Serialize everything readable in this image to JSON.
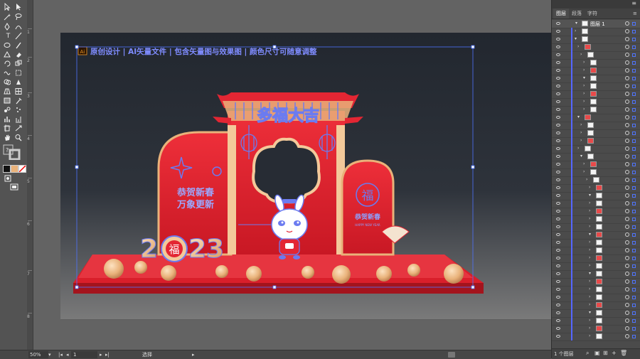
{
  "statusbar": {
    "zoom": "50%",
    "artboard_number": "1",
    "tool_name": "选择"
  },
  "panel": {
    "tabs": [
      "图层",
      "段落",
      "字符"
    ],
    "top_layer_name": "图层 1",
    "footer_count": "1 个图层"
  },
  "ruler": {
    "marks": [
      "1",
      "2",
      "3",
      "4",
      "5",
      "6",
      "7",
      "8"
    ]
  },
  "artwork": {
    "header_badge": "Ai",
    "header_text": "原创设计 | AI矢量文件 | 包含矢量图与效果图 | 颜色尺寸可随意调整",
    "roof_title": "多福大吉",
    "left_line1": "恭贺新春",
    "left_line2": "万象更新",
    "door_fu": "福",
    "door_text": "恭贺新春",
    "door_sub": "HAPPY NEW YEAR",
    "year_left": "2",
    "year_fu": "福",
    "year_right": "23"
  },
  "colors": {
    "accent": "#4f74ff",
    "red": "#e32633",
    "gold": "#e9b27a",
    "blue_art": "#6b7bf0"
  }
}
